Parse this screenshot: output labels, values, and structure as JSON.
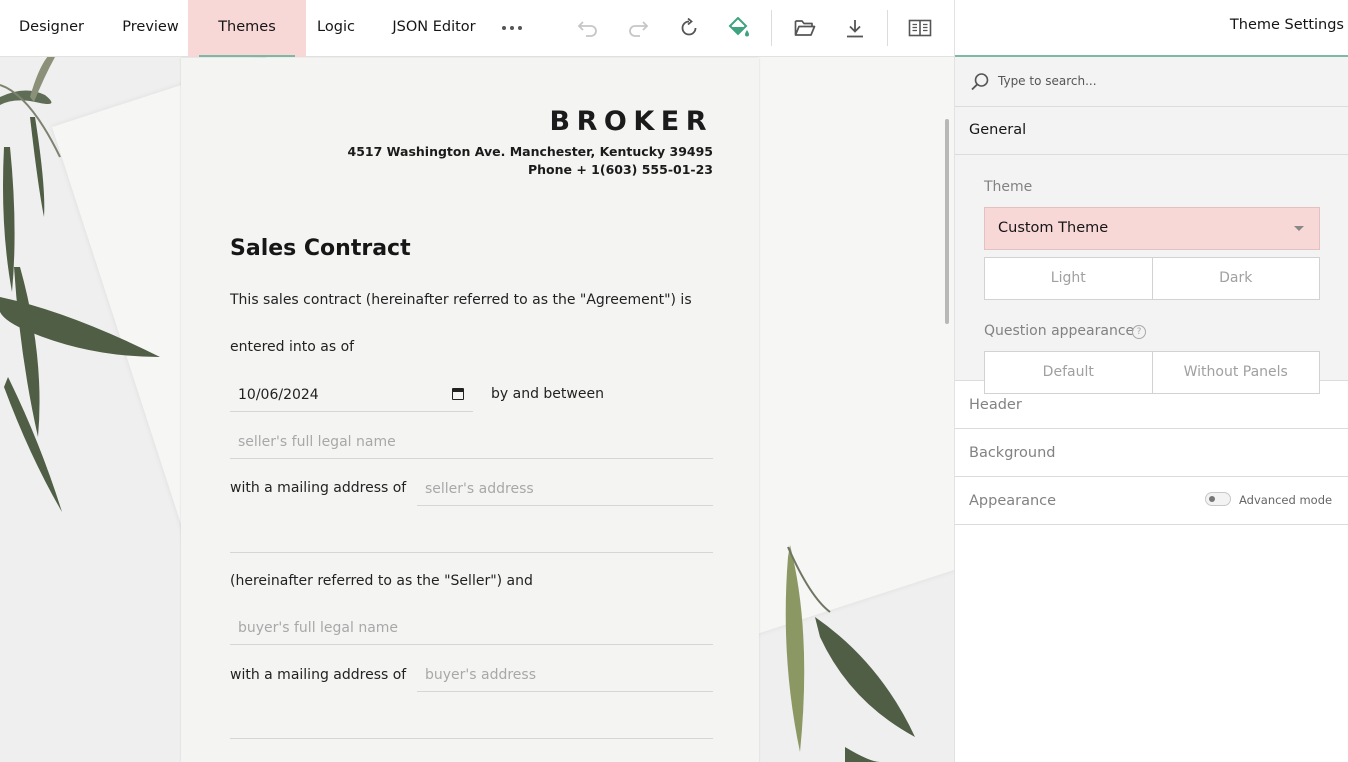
{
  "toolbar": {
    "tabs": [
      {
        "label": "Designer"
      },
      {
        "label": "Preview"
      },
      {
        "label": "Themes"
      },
      {
        "label": "Logic"
      },
      {
        "label": "JSON Editor"
      }
    ],
    "more_icon": "ellipsis-icon",
    "icons": [
      "undo-icon",
      "redo-icon",
      "reset-icon",
      "theme-paint-icon",
      "open-folder-icon",
      "download-icon",
      "book-icon"
    ],
    "accent_color": "#7fb8a4",
    "active_tab_bg": "#f8d7d7"
  },
  "survey": {
    "logo": "BROKER",
    "address_line": "4517 Washington Ave. Manchester, Kentucky 39495",
    "phone_line": "Phone + 1(603) 555-01-23",
    "title": "Sales Contract",
    "intro_line1": "This sales contract (hereinafter referred to as the \"Agreement\") is",
    "intro_line2": "entered into as of",
    "date_value": "10/06/2024",
    "by_and_between": "by and between",
    "seller_name_placeholder": "seller's full legal name",
    "mailing_label_1": "with a mailing address of",
    "seller_address_placeholder": "seller's address",
    "seller_ref": "(hereinafter referred to as the \"Seller\") and",
    "buyer_name_placeholder": "buyer's full legal name",
    "mailing_label_2": "with a mailing address of",
    "buyer_address_placeholder": "buyer's address"
  },
  "panel": {
    "title": "Theme Settings",
    "search_placeholder": "Type to search...",
    "general": {
      "title": "General",
      "theme_label": "Theme",
      "theme_value": "Custom Theme",
      "mode_options": [
        "Light",
        "Dark"
      ],
      "question_appearance_label": "Question appearance",
      "appearance_options": [
        "Default",
        "Without Panels"
      ]
    },
    "sections": [
      {
        "title": "Header"
      },
      {
        "title": "Background"
      },
      {
        "title": "Appearance"
      }
    ],
    "advanced_mode_label": "Advanced mode"
  }
}
